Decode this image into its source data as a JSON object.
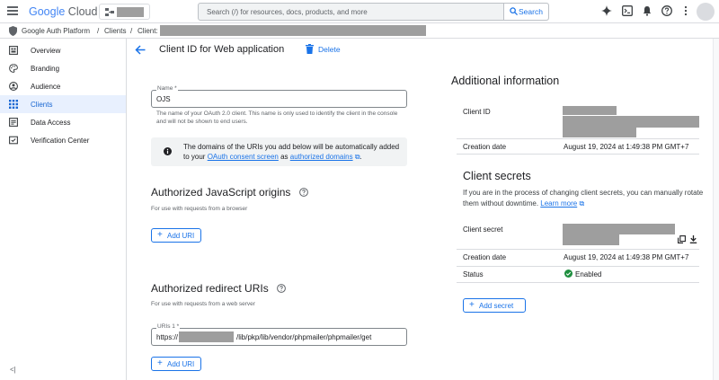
{
  "header": {
    "logo_google": "Google",
    "logo_cloud": "Cloud",
    "search_placeholder": "Search (/) for resources, docs, products, and more",
    "search_button": "Search"
  },
  "breadcrumb": {
    "items": [
      "Google Auth Platform",
      "/",
      "Clients",
      "/",
      "Client:"
    ]
  },
  "sidebar": {
    "items": [
      {
        "label": "Overview",
        "icon": "overview-icon"
      },
      {
        "label": "Branding",
        "icon": "palette-icon"
      },
      {
        "label": "Audience",
        "icon": "person-circle-icon"
      },
      {
        "label": "Clients",
        "icon": "key-grid-icon",
        "active": true
      },
      {
        "label": "Data Access",
        "icon": "lock-list-icon"
      },
      {
        "label": "Verification Center",
        "icon": "verification-icon"
      }
    ],
    "collapse_label": "<|"
  },
  "main": {
    "title": "Client ID for Web application",
    "delete_label": "Delete",
    "name_field": {
      "label": "Name *",
      "value": "OJS",
      "help": "The name of your OAuth 2.0 client. This name is only used to identify the client in the console and will not be shown to end users."
    },
    "info_box": {
      "text_before": "The domains of the URIs you add below will be automatically added to your ",
      "link1": "OAuth consent screen",
      "text_middle": " as ",
      "link2": "authorized domains",
      "link_mark": "⧉",
      "text_after": "."
    },
    "js_origins": {
      "title": "Authorized JavaScript origins",
      "help": "For use with requests from a browser",
      "add_label": "Add URI"
    },
    "redirect_uris": {
      "title": "Authorized redirect URIs",
      "help": "For use with requests from a web server",
      "uri_label": "URIs 1 *",
      "uri_prefix": "https://",
      "uri_suffix": "/lib/pkp/lib/vendor/phpmailer/phpmailer/get",
      "add_label": "Add URI"
    }
  },
  "right_panel": {
    "title": "Additional information",
    "client_id_label": "Client ID",
    "creation_label": "Creation date",
    "creation_value": "August 19, 2024 at 1:49:38 PM GMT+7",
    "secrets_title": "Client secrets",
    "secrets_desc": "If you are in the process of changing client secrets, you can manually rotate them without downtime.",
    "learn_more": "Learn more",
    "secret_label": "Client secret",
    "secret_creation_label": "Creation date",
    "secret_creation_value": "August 19, 2024 at 1:49:38 PM GMT+7",
    "status_label": "Status",
    "status_value": "Enabled",
    "add_secret_label": "Add secret"
  },
  "colors": {
    "accent": "#1a73e8",
    "active_nav_bg": "#e8f0fe",
    "enabled_green": "#1e8e3e",
    "redaction_gray": "#9e9e9e"
  }
}
